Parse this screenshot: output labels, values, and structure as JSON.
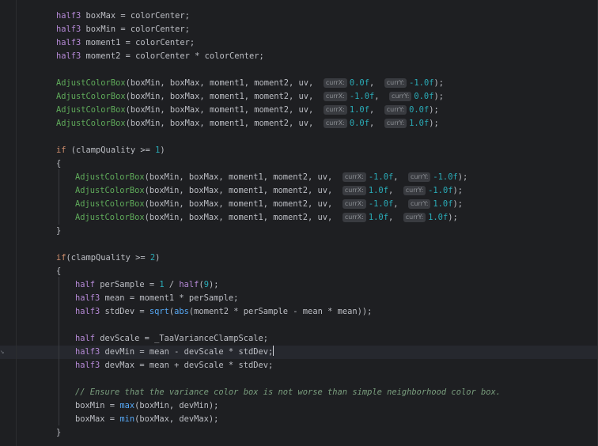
{
  "editor": {
    "lines": [
      {
        "indent": 1,
        "tokens": [
          [
            "type",
            "half3"
          ],
          [
            "id",
            " "
          ],
          [
            "id",
            "boxMax"
          ],
          [
            "id",
            " = colorCenter;"
          ]
        ]
      },
      {
        "indent": 1,
        "tokens": [
          [
            "type",
            "half3"
          ],
          [
            "id",
            " "
          ],
          [
            "id",
            "boxMin"
          ],
          [
            "id",
            " = colorCenter;"
          ]
        ]
      },
      {
        "indent": 1,
        "tokens": [
          [
            "type",
            "half3"
          ],
          [
            "id",
            " moment1 = colorCenter;"
          ]
        ]
      },
      {
        "indent": 1,
        "tokens": [
          [
            "type",
            "half3"
          ],
          [
            "id",
            " moment2 = colorCenter * colorCenter;"
          ]
        ]
      },
      {
        "indent": 0,
        "tokens": []
      },
      {
        "indent": 1,
        "tokens": [
          [
            "mac",
            "AdjustColorBox"
          ],
          [
            "id",
            "(boxMin, boxMax, moment1, moment2, uv,  "
          ],
          [
            "hint",
            "currX:"
          ],
          [
            "num",
            "0.0f"
          ],
          [
            "id",
            ",  "
          ],
          [
            "hint",
            "currY:"
          ],
          [
            "num",
            "-1.0f"
          ],
          [
            "id",
            ");"
          ]
        ]
      },
      {
        "indent": 1,
        "tokens": [
          [
            "mac",
            "AdjustColorBox"
          ],
          [
            "id",
            "(boxMin, boxMax, moment1, moment2, uv,  "
          ],
          [
            "hint",
            "currX:"
          ],
          [
            "num",
            "-1.0f"
          ],
          [
            "id",
            ",  "
          ],
          [
            "hint",
            "currY:"
          ],
          [
            "num",
            "0.0f"
          ],
          [
            "id",
            ");"
          ]
        ]
      },
      {
        "indent": 1,
        "tokens": [
          [
            "mac",
            "AdjustColorBox"
          ],
          [
            "id",
            "(boxMin, boxMax, moment1, moment2, uv,  "
          ],
          [
            "hint",
            "currX:"
          ],
          [
            "num",
            "1.0f"
          ],
          [
            "id",
            ",  "
          ],
          [
            "hint",
            "currY:"
          ],
          [
            "num",
            "0.0f"
          ],
          [
            "id",
            ");"
          ]
        ]
      },
      {
        "indent": 1,
        "tokens": [
          [
            "mac",
            "AdjustColorBox"
          ],
          [
            "id",
            "(boxMin, boxMax, moment1, moment2, uv,  "
          ],
          [
            "hint",
            "currX:"
          ],
          [
            "num",
            "0.0f"
          ],
          [
            "id",
            ",  "
          ],
          [
            "hint",
            "currY:"
          ],
          [
            "num",
            "1.0f"
          ],
          [
            "id",
            ");"
          ]
        ]
      },
      {
        "indent": 0,
        "tokens": []
      },
      {
        "indent": 1,
        "tokens": [
          [
            "kw",
            "if"
          ],
          [
            "id",
            " (clampQuality >= "
          ],
          [
            "num",
            "1"
          ],
          [
            "id",
            ")"
          ]
        ]
      },
      {
        "indent": 1,
        "tokens": [
          [
            "id",
            "{"
          ]
        ]
      },
      {
        "indent": 2,
        "tokens": [
          [
            "mac",
            "AdjustColorBox"
          ],
          [
            "id",
            "(boxMin, boxMax, moment1, moment2, uv,  "
          ],
          [
            "hint",
            "currX:"
          ],
          [
            "num",
            "-1.0f"
          ],
          [
            "id",
            ",  "
          ],
          [
            "hint",
            "currY:"
          ],
          [
            "num",
            "-1.0f"
          ],
          [
            "id",
            ");"
          ]
        ]
      },
      {
        "indent": 2,
        "tokens": [
          [
            "mac",
            "AdjustColorBox"
          ],
          [
            "id",
            "(boxMin, boxMax, moment1, moment2, uv,  "
          ],
          [
            "hint",
            "currX:"
          ],
          [
            "num",
            "1.0f"
          ],
          [
            "id",
            ",  "
          ],
          [
            "hint",
            "currY:"
          ],
          [
            "num",
            "-1.0f"
          ],
          [
            "id",
            ");"
          ]
        ]
      },
      {
        "indent": 2,
        "tokens": [
          [
            "mac",
            "AdjustColorBox"
          ],
          [
            "id",
            "(boxMin, boxMax, moment1, moment2, uv,  "
          ],
          [
            "hint",
            "currX:"
          ],
          [
            "num",
            "-1.0f"
          ],
          [
            "id",
            ",  "
          ],
          [
            "hint",
            "currY:"
          ],
          [
            "num",
            "1.0f"
          ],
          [
            "id",
            ");"
          ]
        ]
      },
      {
        "indent": 2,
        "tokens": [
          [
            "mac",
            "AdjustColorBox"
          ],
          [
            "id",
            "(boxMin, boxMax, moment1, moment2, uv,  "
          ],
          [
            "hint",
            "currX:"
          ],
          [
            "num",
            "1.0f"
          ],
          [
            "id",
            ",  "
          ],
          [
            "hint",
            "currY:"
          ],
          [
            "num",
            "1.0f"
          ],
          [
            "id",
            ");"
          ]
        ]
      },
      {
        "indent": 1,
        "tokens": [
          [
            "id",
            "}"
          ]
        ]
      },
      {
        "indent": 0,
        "tokens": []
      },
      {
        "indent": 1,
        "tokens": [
          [
            "kw",
            "if"
          ],
          [
            "id",
            "(clampQuality >= "
          ],
          [
            "num",
            "2"
          ],
          [
            "id",
            ")"
          ]
        ]
      },
      {
        "indent": 1,
        "tokens": [
          [
            "id",
            "{"
          ]
        ]
      },
      {
        "indent": 2,
        "tokens": [
          [
            "type",
            "half"
          ],
          [
            "id",
            " perSample = "
          ],
          [
            "num",
            "1"
          ],
          [
            "id",
            " / "
          ],
          [
            "type",
            "half"
          ],
          [
            "id",
            "("
          ],
          [
            "num",
            "9"
          ],
          [
            "id",
            ");"
          ]
        ]
      },
      {
        "indent": 2,
        "tokens": [
          [
            "type",
            "half3"
          ],
          [
            "id",
            " mean = moment1 * perSample;"
          ]
        ]
      },
      {
        "indent": 2,
        "tokens": [
          [
            "type",
            "half3"
          ],
          [
            "id",
            " stdDev = "
          ],
          [
            "call",
            "sqrt"
          ],
          [
            "id",
            "("
          ],
          [
            "call",
            "abs"
          ],
          [
            "id",
            "(moment2 * perSample - mean * mean));"
          ]
        ]
      },
      {
        "indent": 0,
        "tokens": []
      },
      {
        "indent": 2,
        "tokens": [
          [
            "type",
            "half"
          ],
          [
            "id",
            " devScale = _TaaVarianceClampScale;"
          ]
        ]
      },
      {
        "indent": 2,
        "tokens": [
          [
            "type",
            "half3"
          ],
          [
            "id",
            " devMin = mean - devScale * stdDev;"
          ]
        ],
        "caret": true
      },
      {
        "indent": 2,
        "tokens": [
          [
            "type",
            "half3"
          ],
          [
            "id",
            " devMax = mean + devScale * stdDev;"
          ]
        ]
      },
      {
        "indent": 0,
        "tokens": []
      },
      {
        "indent": 2,
        "tokens": [
          [
            "cmt",
            "// Ensure that the variance color box is not worse than simple neighborhood color box."
          ]
        ]
      },
      {
        "indent": 2,
        "tokens": [
          [
            "id",
            "boxMin = "
          ],
          [
            "call",
            "max"
          ],
          [
            "id",
            "(boxMin, devMin);"
          ]
        ]
      },
      {
        "indent": 2,
        "tokens": [
          [
            "id",
            "boxMax = "
          ],
          [
            "call",
            "min"
          ],
          [
            "id",
            "(boxMax, devMax);"
          ]
        ]
      },
      {
        "indent": 1,
        "tokens": [
          [
            "id",
            "}"
          ]
        ]
      }
    ]
  }
}
